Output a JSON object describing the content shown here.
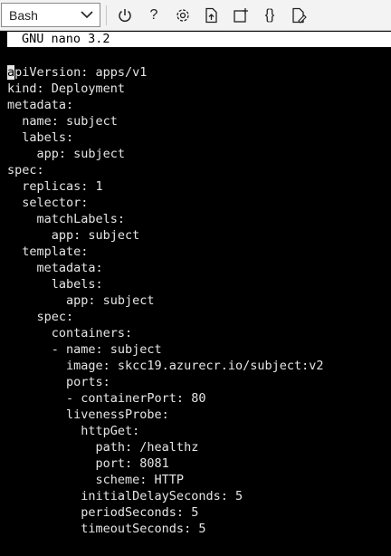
{
  "toolbar": {
    "shell_selected": "Bash",
    "help_label": "?",
    "braces_label": "{}",
    "icons": [
      "power-icon",
      "help-icon",
      "gear-icon",
      "upload-file-icon",
      "new-session-icon",
      "braces-icon",
      "open-editor-icon"
    ]
  },
  "nano": {
    "header": "GNU nano 3.2"
  },
  "editor": {
    "cursor_char": "a",
    "lines": [
      "piVersion: apps/v1",
      "kind: Deployment",
      "metadata:",
      "  name: subject",
      "  labels:",
      "    app: subject",
      "spec:",
      "  replicas: 1",
      "  selector:",
      "    matchLabels:",
      "      app: subject",
      "  template:",
      "    metadata:",
      "      labels:",
      "        app: subject",
      "    spec:",
      "      containers:",
      "      - name: subject",
      "        image: skcc19.azurecr.io/subject:v2",
      "        ports:",
      "        - containerPort: 80",
      "        livenessProbe:",
      "          httpGet:",
      "            path: /healthz",
      "            port: 8081",
      "            scheme: HTTP",
      "          initialDelaySeconds: 5",
      "          periodSeconds: 5",
      "          timeoutSeconds: 5"
    ]
  },
  "colors": {
    "toolbar_bg": "#f3f3f3",
    "terminal_bg": "#000000",
    "terminal_fg": "#e6e6e6",
    "header_bg": "#ffffff"
  }
}
